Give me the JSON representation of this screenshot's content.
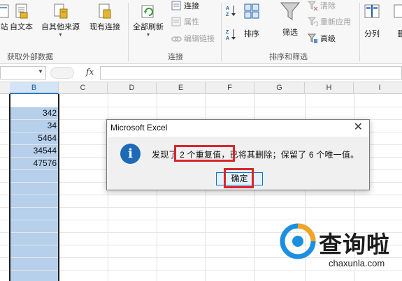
{
  "ribbon": {
    "get_external_data": {
      "label": "获取外部数据",
      "buttons": [
        {
          "label": "站",
          "icon": "web-icon"
        },
        {
          "label": "自文本",
          "icon": "text-file-icon"
        },
        {
          "label": "自其他来源",
          "icon": "other-sources-icon"
        },
        {
          "label": "现有连接",
          "icon": "existing-connections-icon"
        }
      ]
    },
    "connections": {
      "label": "连接",
      "refresh_all": "全部刷新",
      "items": [
        {
          "label": "连接",
          "icon": "connections-icon",
          "disabled": false
        },
        {
          "label": "属性",
          "icon": "properties-icon",
          "disabled": true
        },
        {
          "label": "编辑链接",
          "icon": "edit-links-icon",
          "disabled": true
        }
      ]
    },
    "sort_filter": {
      "label": "排序和筛选",
      "sort": "排序",
      "filter": "筛选",
      "sort_az_icon": "sort-az-icon",
      "sort_za_icon": "sort-za-icon",
      "items": [
        {
          "label": "清除",
          "icon": "clear-icon",
          "disabled": true
        },
        {
          "label": "重新应用",
          "icon": "reapply-icon",
          "disabled": true
        },
        {
          "label": "高级",
          "icon": "advanced-icon",
          "disabled": false
        }
      ]
    },
    "data_tools": {
      "text_to_columns": "分列",
      "remove_duplicates_partial": "删"
    }
  },
  "formula_bar": {
    "fx_label": "fx",
    "value": ""
  },
  "grid": {
    "columns": [
      "B",
      "C",
      "D",
      "E",
      "F",
      "G",
      "H",
      "I"
    ],
    "selected_column": "B",
    "values": [
      "342",
      "34",
      "5464",
      "34544",
      "47576"
    ]
  },
  "dialog": {
    "title": "Microsoft Excel",
    "close": "✕",
    "icon_glyph": "i",
    "message": "发现了 2 个重复值，已将其删除；保留了 6 个唯一值。",
    "ok": "确定"
  },
  "watermark": {
    "text": "查询啦",
    "url": "chaxunla.com"
  },
  "colors": {
    "selection": "#b6cfeb",
    "highlight_red": "#d9262b",
    "info_blue": "#1f6ab7"
  }
}
